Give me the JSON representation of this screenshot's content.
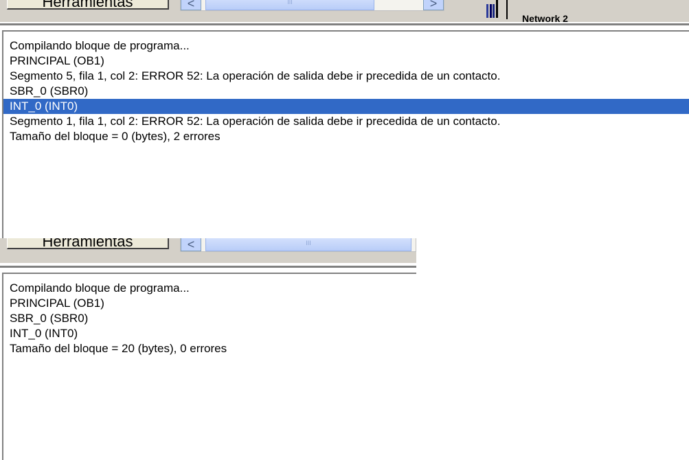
{
  "shot1": {
    "tab_label": "Herramientas",
    "network_label": "Network 2",
    "scroll_thumb_grip": "III",
    "scroll_left_arrow": "<",
    "scroll_right_arrow": ">",
    "output_lines": [
      "Compilando bloque de programa...",
      "PRINCIPAL (OB1)",
      "Segmento 5, fila 1, col 2: ERROR 52: La operación de salida debe ir precedida de un contacto.",
      "SBR_0 (SBR0)",
      "INT_0 (INT0)",
      "Segmento 1, fila 1, col 2: ERROR 52: La operación de salida debe ir precedida de un contacto.",
      "Tamaño del bloque = 0 (bytes), 2 errores"
    ],
    "selected_line": 4
  },
  "shot2": {
    "tab_label": "Herramientas",
    "scroll_thumb_grip": "III",
    "scroll_left_arrow": "<",
    "output_lines": [
      "Compilando bloque de programa...",
      "PRINCIPAL (OB1)",
      "SBR_0 (SBR0)",
      "INT_0 (INT0)",
      "Tamaño del bloque = 20 (bytes), 0 errores"
    ]
  },
  "colors": {
    "selection": "#3169c6",
    "toolbar": "#d4d0c8",
    "panel": "#ffffff"
  }
}
